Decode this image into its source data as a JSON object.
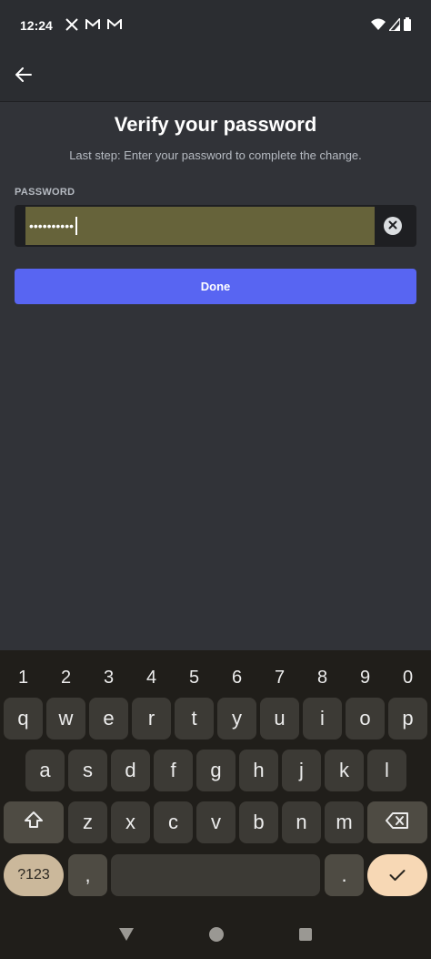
{
  "status_bar": {
    "time": "12:24",
    "left_icons": [
      "x-icon",
      "gmail-icon",
      "gmail-icon"
    ],
    "right_icons": [
      "wifi-icon",
      "signal-icon",
      "battery-icon"
    ]
  },
  "header": {
    "back_icon": "arrow-left-icon"
  },
  "main": {
    "title": "Verify your password",
    "subtitle": "Last step: Enter your password to complete the change.",
    "password_label": "PASSWORD",
    "password_value": "••••••••••",
    "done_label": "Done"
  },
  "keyboard": {
    "numbers": [
      "1",
      "2",
      "3",
      "4",
      "5",
      "6",
      "7",
      "8",
      "9",
      "0"
    ],
    "row1": [
      "q",
      "w",
      "e",
      "r",
      "t",
      "y",
      "u",
      "i",
      "o",
      "p"
    ],
    "row2": [
      "a",
      "s",
      "d",
      "f",
      "g",
      "h",
      "j",
      "k",
      "l"
    ],
    "row3": [
      "z",
      "x",
      "c",
      "v",
      "b",
      "n",
      "m"
    ],
    "symbols_label": "?123",
    "comma": ",",
    "period": "."
  },
  "colors": {
    "background": "#313338",
    "accent": "#5865f2",
    "autofill_highlight": "#66633a"
  }
}
